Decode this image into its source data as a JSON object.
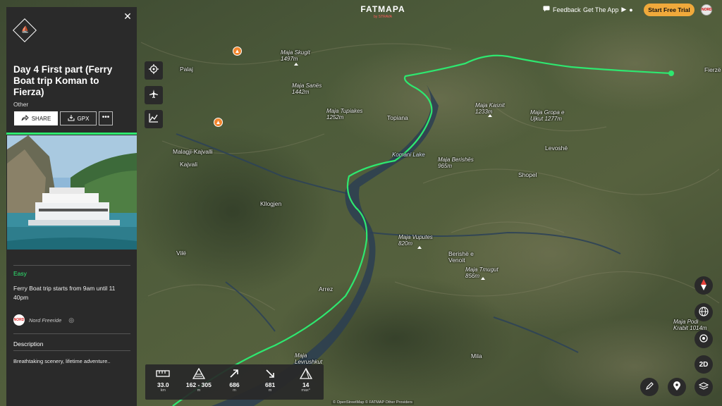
{
  "app": {
    "brand": "FATMAPA",
    "brand_sub": "by STRAVA",
    "feedback": "Feedback",
    "get_app": "Get The App",
    "start_trial": "Start Free Trial",
    "avatar_text": "NORD"
  },
  "panel": {
    "title": "Day 4 First part (Ferry Boat trip Koman to Fierza)",
    "type": "Other",
    "share": "SHARE",
    "gpx": "GPX",
    "more": "•••",
    "difficulty": "Easy",
    "short_desc": "Ferry Boat trip starts from 9am until 11 40pm",
    "author": "Nord Freeride",
    "author_logo": "NORD",
    "description_heading": "Description",
    "description_text": "Breathtaking scenery, lifetime adventure.."
  },
  "stats": [
    {
      "value": "33.0",
      "unit": "km",
      "icon": "distance-icon"
    },
    {
      "value": "162 - 305",
      "unit": "m",
      "icon": "elevation-range-icon"
    },
    {
      "value": "686",
      "unit": "m",
      "icon": "ascent-icon"
    },
    {
      "value": "681",
      "unit": "m",
      "icon": "descent-icon"
    },
    {
      "value": "14",
      "unit": "max°",
      "icon": "slope-icon"
    }
  ],
  "map": {
    "labels": {
      "skugit": "Maja Skugit\n1497m",
      "sanes": "Maja Sanës\n1442m",
      "tupiakes": "Maja Tupiakes\n1252m",
      "topiana": "Topiana",
      "komani_lake": "Komani Lake",
      "kasnit": "Maja Kasnit\n1233m",
      "gropa": "Maja Gropa e\nUjkut 1277m",
      "levoshe": "Levoshë",
      "berishes": "Maja Berishës\n965m",
      "shopel": "Shopel",
      "malagji": "Malagji-Kajvalli",
      "kajvali": "Kajvali",
      "palaj": "Palaj",
      "kllogjen": "Kllogjen",
      "vuputes": "Maja Vuputes\n820m",
      "berishe": "Berishë e\nVenoit",
      "tmugut": "Maja Tmugut\n856m",
      "vile": "Vilë",
      "arrez": "Arrez",
      "podi": "Maja Podi\nKrabit 1014m",
      "levrushkut": "Maja\nLevrushkut",
      "mila": "Mila",
      "fierze": "Fierzë"
    },
    "attribution": "© OpenStreetMap © FATMAP Other Providers"
  },
  "controls": {
    "mode_2d": "2D"
  }
}
